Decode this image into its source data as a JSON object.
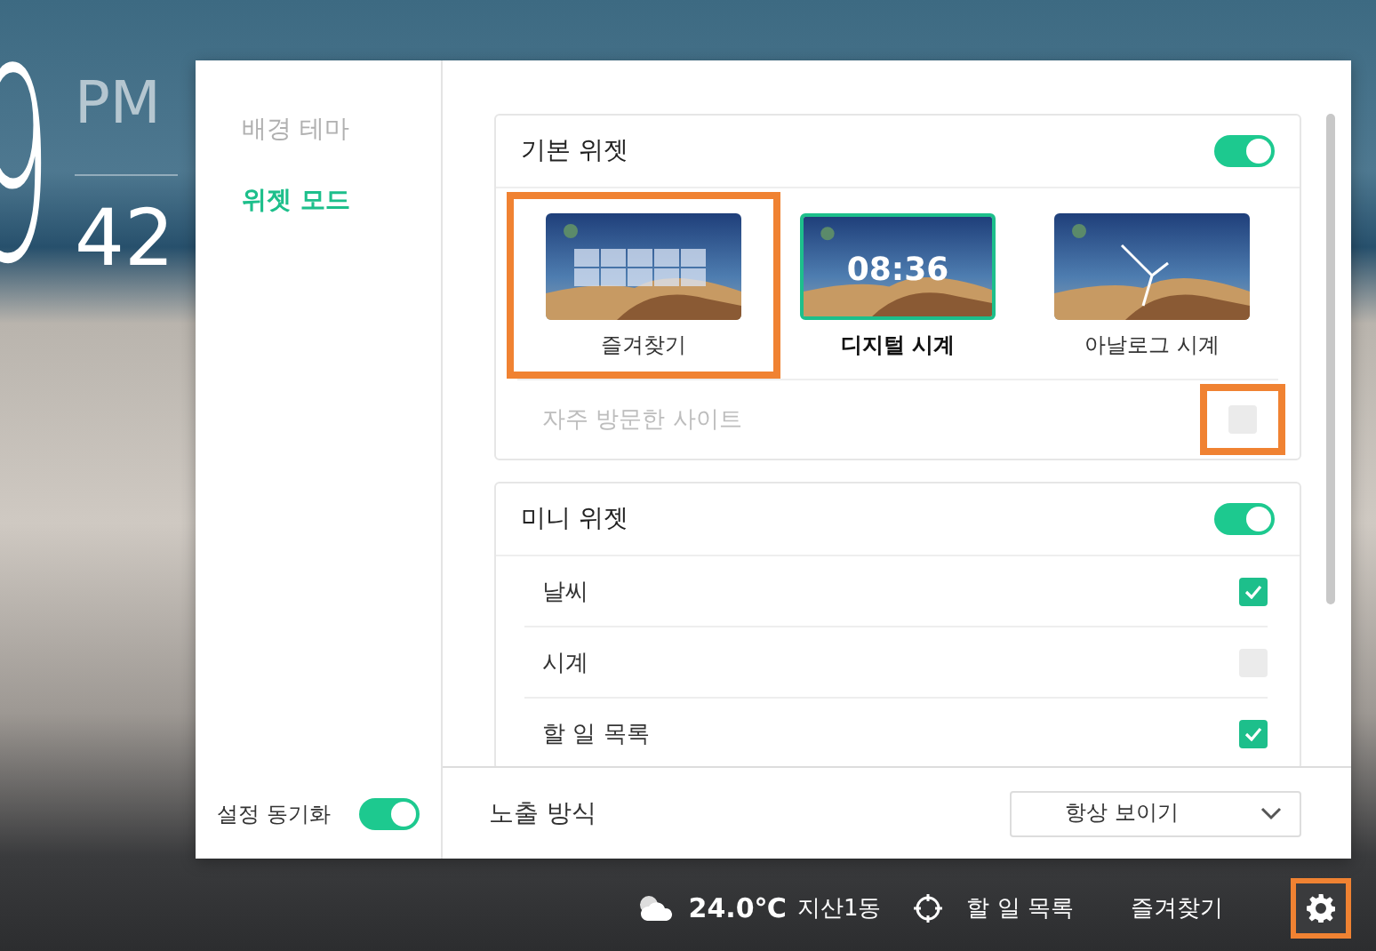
{
  "clock": {
    "hour": "9",
    "ampm": "PM",
    "minute": "42"
  },
  "sidebar": {
    "items": [
      {
        "label": "배경 테마",
        "selected": false
      },
      {
        "label": "위젯 모드",
        "selected": true
      }
    ],
    "sync": {
      "label": "설정 동기화",
      "on": true
    }
  },
  "basic_widget": {
    "title": "기본 위젯",
    "on": true,
    "tiles": [
      {
        "kind": "grid",
        "label": "즐겨찾기",
        "selected": false,
        "highlighted": true
      },
      {
        "kind": "digital",
        "label": "디지털 시계",
        "time": "08:36",
        "selected": true,
        "highlighted": false
      },
      {
        "kind": "analog",
        "label": "아날로그 시계",
        "selected": false,
        "highlighted": false
      }
    ],
    "option": {
      "label": "자주 방문한 사이트",
      "checked": false,
      "disabled": true,
      "highlighted": true
    }
  },
  "mini_widget": {
    "title": "미니 위젯",
    "on": true,
    "items": [
      {
        "label": "날씨",
        "checked": true
      },
      {
        "label": "시계",
        "checked": false
      },
      {
        "label": "할 일 목록",
        "checked": true
      }
    ]
  },
  "display_mode": {
    "label": "노출 방식",
    "value": "항상 보이기"
  },
  "taskbar": {
    "temperature": "24.0℃",
    "location": "지산1동",
    "todo": "할 일 목록",
    "favorites": "즐겨찾기",
    "settings_highlighted": true
  }
}
